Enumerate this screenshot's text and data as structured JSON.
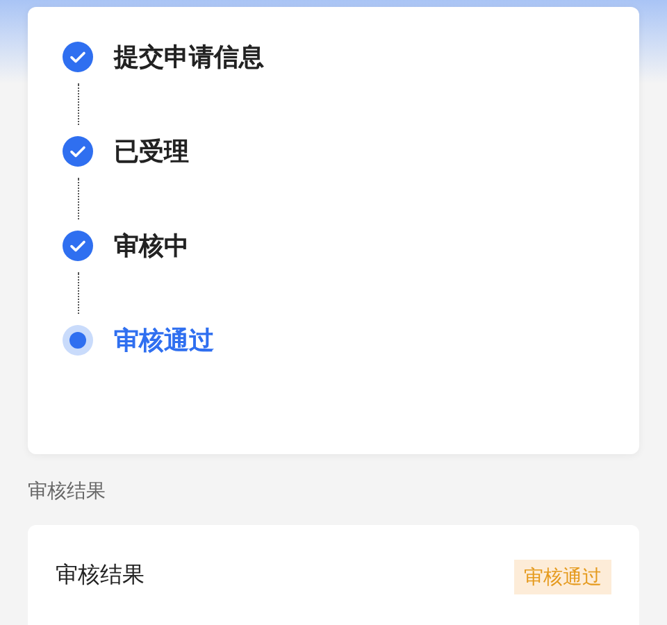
{
  "steps": [
    {
      "label": "提交申请信息",
      "kind": "done"
    },
    {
      "label": "已受理",
      "kind": "done"
    },
    {
      "label": "审核中",
      "kind": "done"
    },
    {
      "label": "审核通过",
      "kind": "current"
    }
  ],
  "section_title": "审核结果",
  "result": {
    "label": "审核结果",
    "badge": "审核通过"
  }
}
